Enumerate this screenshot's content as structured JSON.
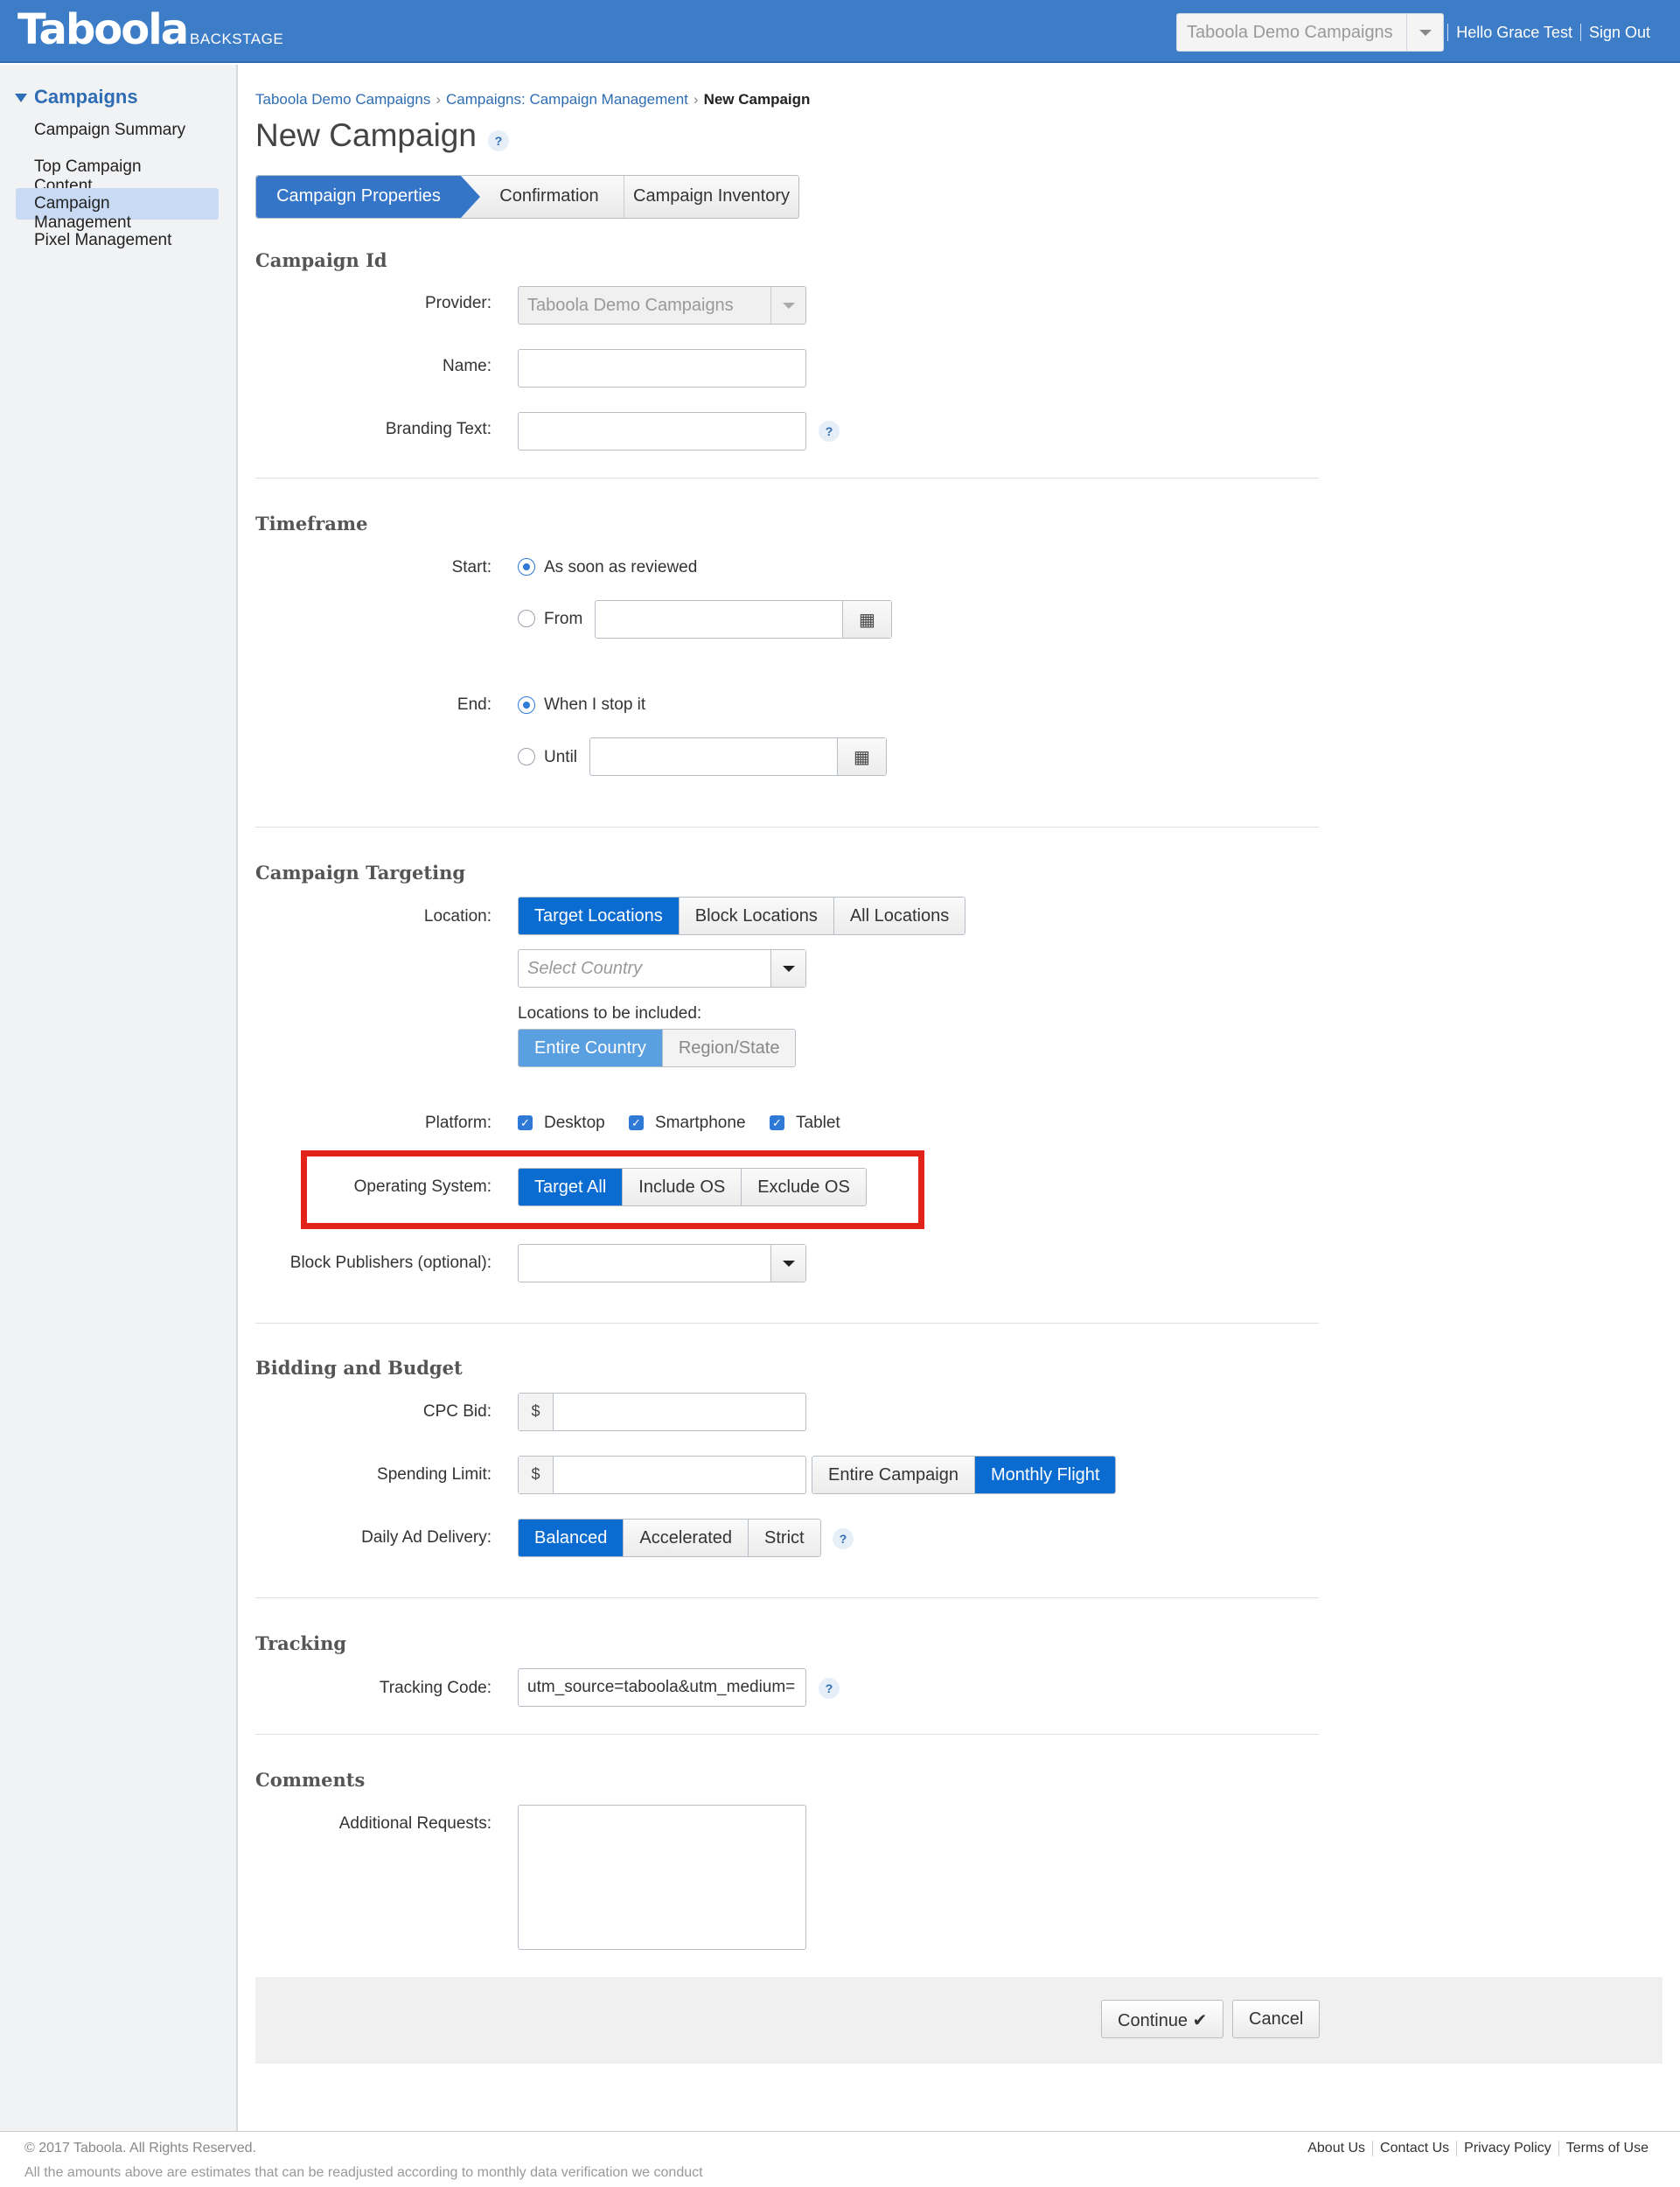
{
  "header": {
    "logo": "Taboola",
    "logo_sub": "BACKSTAGE",
    "account_select": "Taboola Demo Campaigns",
    "greeting": "Hello Grace Test",
    "sign_out": "Sign Out"
  },
  "sidebar": {
    "heading": "Campaigns",
    "items": [
      {
        "label": "Campaign Summary"
      },
      {
        "label": "Top Campaign Content"
      },
      {
        "label": "Campaign Management"
      },
      {
        "label": "Pixel Management"
      }
    ]
  },
  "breadcrumb": {
    "items": [
      "Taboola Demo Campaigns",
      "Campaigns: Campaign Management"
    ],
    "current": "New Campaign",
    "separator": "›"
  },
  "page_title": "New Campaign",
  "help_glyph": "?",
  "wizard": {
    "steps": [
      "Campaign Properties",
      "Confirmation",
      "Campaign Inventory"
    ]
  },
  "campaign_id": {
    "title": "Campaign Id",
    "provider_label": "Provider:",
    "provider_value": "Taboola Demo Campaigns",
    "name_label": "Name:",
    "branding_label": "Branding Text:"
  },
  "timeframe": {
    "title": "Timeframe",
    "start_label": "Start:",
    "start_opt1": "As soon as reviewed",
    "start_opt2": "From",
    "end_label": "End:",
    "end_opt1": "When I stop it",
    "end_opt2": "Until"
  },
  "targeting": {
    "title": "Campaign Targeting",
    "location_label": "Location:",
    "location_tabs": [
      "Target Locations",
      "Block Locations",
      "All Locations"
    ],
    "country_placeholder": "Select Country",
    "included_label": "Locations to be included:",
    "included_tabs": [
      "Entire Country",
      "Region/State"
    ],
    "platform_label": "Platform:",
    "platforms": [
      "Desktop",
      "Smartphone",
      "Tablet"
    ],
    "os_label": "Operating System:",
    "os_tabs": [
      "Target All",
      "Include OS",
      "Exclude OS"
    ],
    "block_pub_label": "Block Publishers (optional):"
  },
  "bidding": {
    "title": "Bidding and Budget",
    "cpc_label": "CPC Bid:",
    "currency": "$",
    "spend_label": "Spending Limit:",
    "spend_tabs": [
      "Entire Campaign",
      "Monthly Flight"
    ],
    "delivery_label": "Daily Ad Delivery:",
    "delivery_tabs": [
      "Balanced",
      "Accelerated",
      "Strict"
    ]
  },
  "tracking": {
    "title": "Tracking",
    "code_label": "Tracking Code:",
    "code_value": "utm_source=taboola&utm_medium="
  },
  "comments": {
    "title": "Comments",
    "requests_label": "Additional Requests:"
  },
  "actions": {
    "continue": "Continue ✔",
    "cancel": "Cancel"
  },
  "footer": {
    "copyright": "© 2017 Taboola. All Rights Reserved.",
    "note": "All the amounts above are estimates that can be readjusted according to monthly data verification we conduct",
    "links": [
      "About Us",
      "Contact Us",
      "Privacy Policy",
      "Terms of Use"
    ]
  },
  "colors": {
    "brand": "#3d7cc6",
    "active_tab": "#0a6bd1",
    "highlight": "#e2231a"
  }
}
